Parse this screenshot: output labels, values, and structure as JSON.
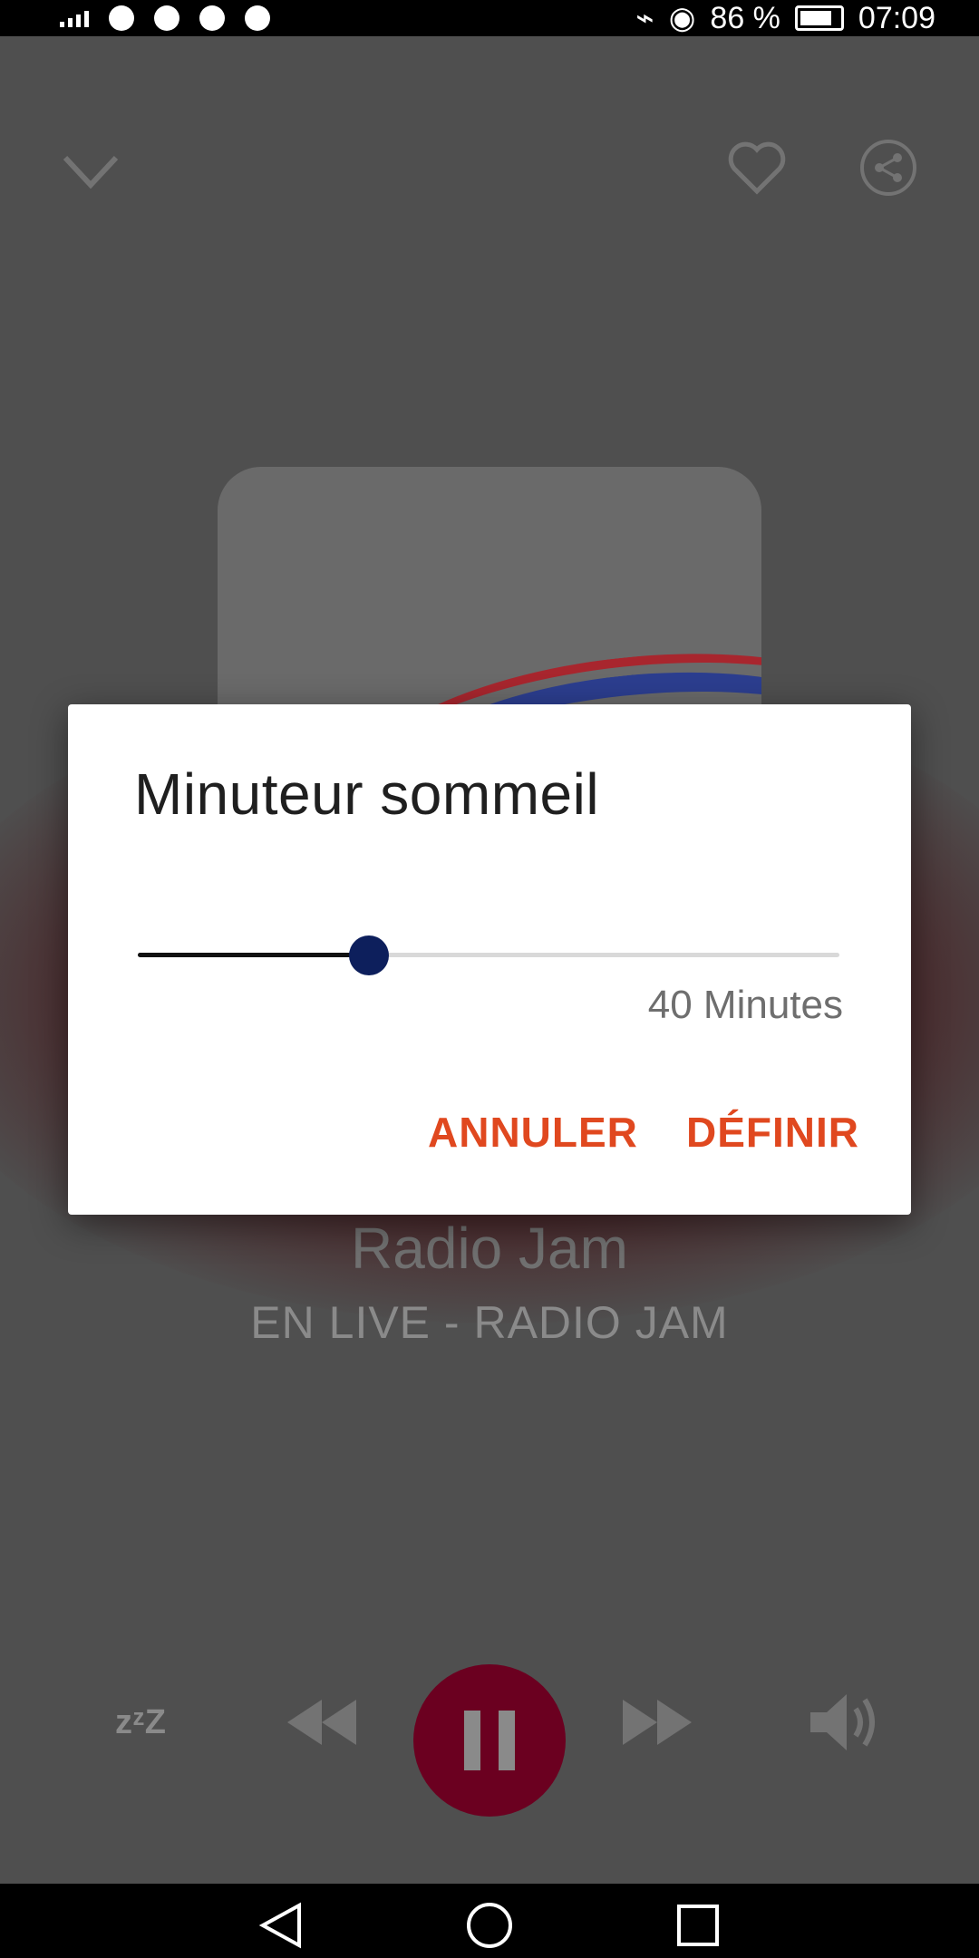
{
  "status_bar": {
    "battery_text": "86 %",
    "time": "07:09"
  },
  "player": {
    "station_name": "Radio Jam",
    "station_subtitle": "EN LIVE - RADIO JAM",
    "icons": [
      "chevron-down-icon",
      "heart-icon",
      "share-icon",
      "sleep-icon",
      "rewind-icon",
      "pause-icon",
      "fast-forward-icon",
      "volume-icon"
    ],
    "play_button_color": "#6b0020"
  },
  "dialog": {
    "title": "Minuteur sommeil",
    "slider_fraction": 0.33,
    "slider_value_label": "40 Minutes",
    "cancel_label": "ANNULER",
    "confirm_label": "DÉFINIR",
    "accent_color": "#e0481f",
    "thumb_color": "#0d1f5c"
  },
  "nav_bar": {
    "icons": [
      "back-icon",
      "home-icon",
      "recents-icon"
    ]
  }
}
